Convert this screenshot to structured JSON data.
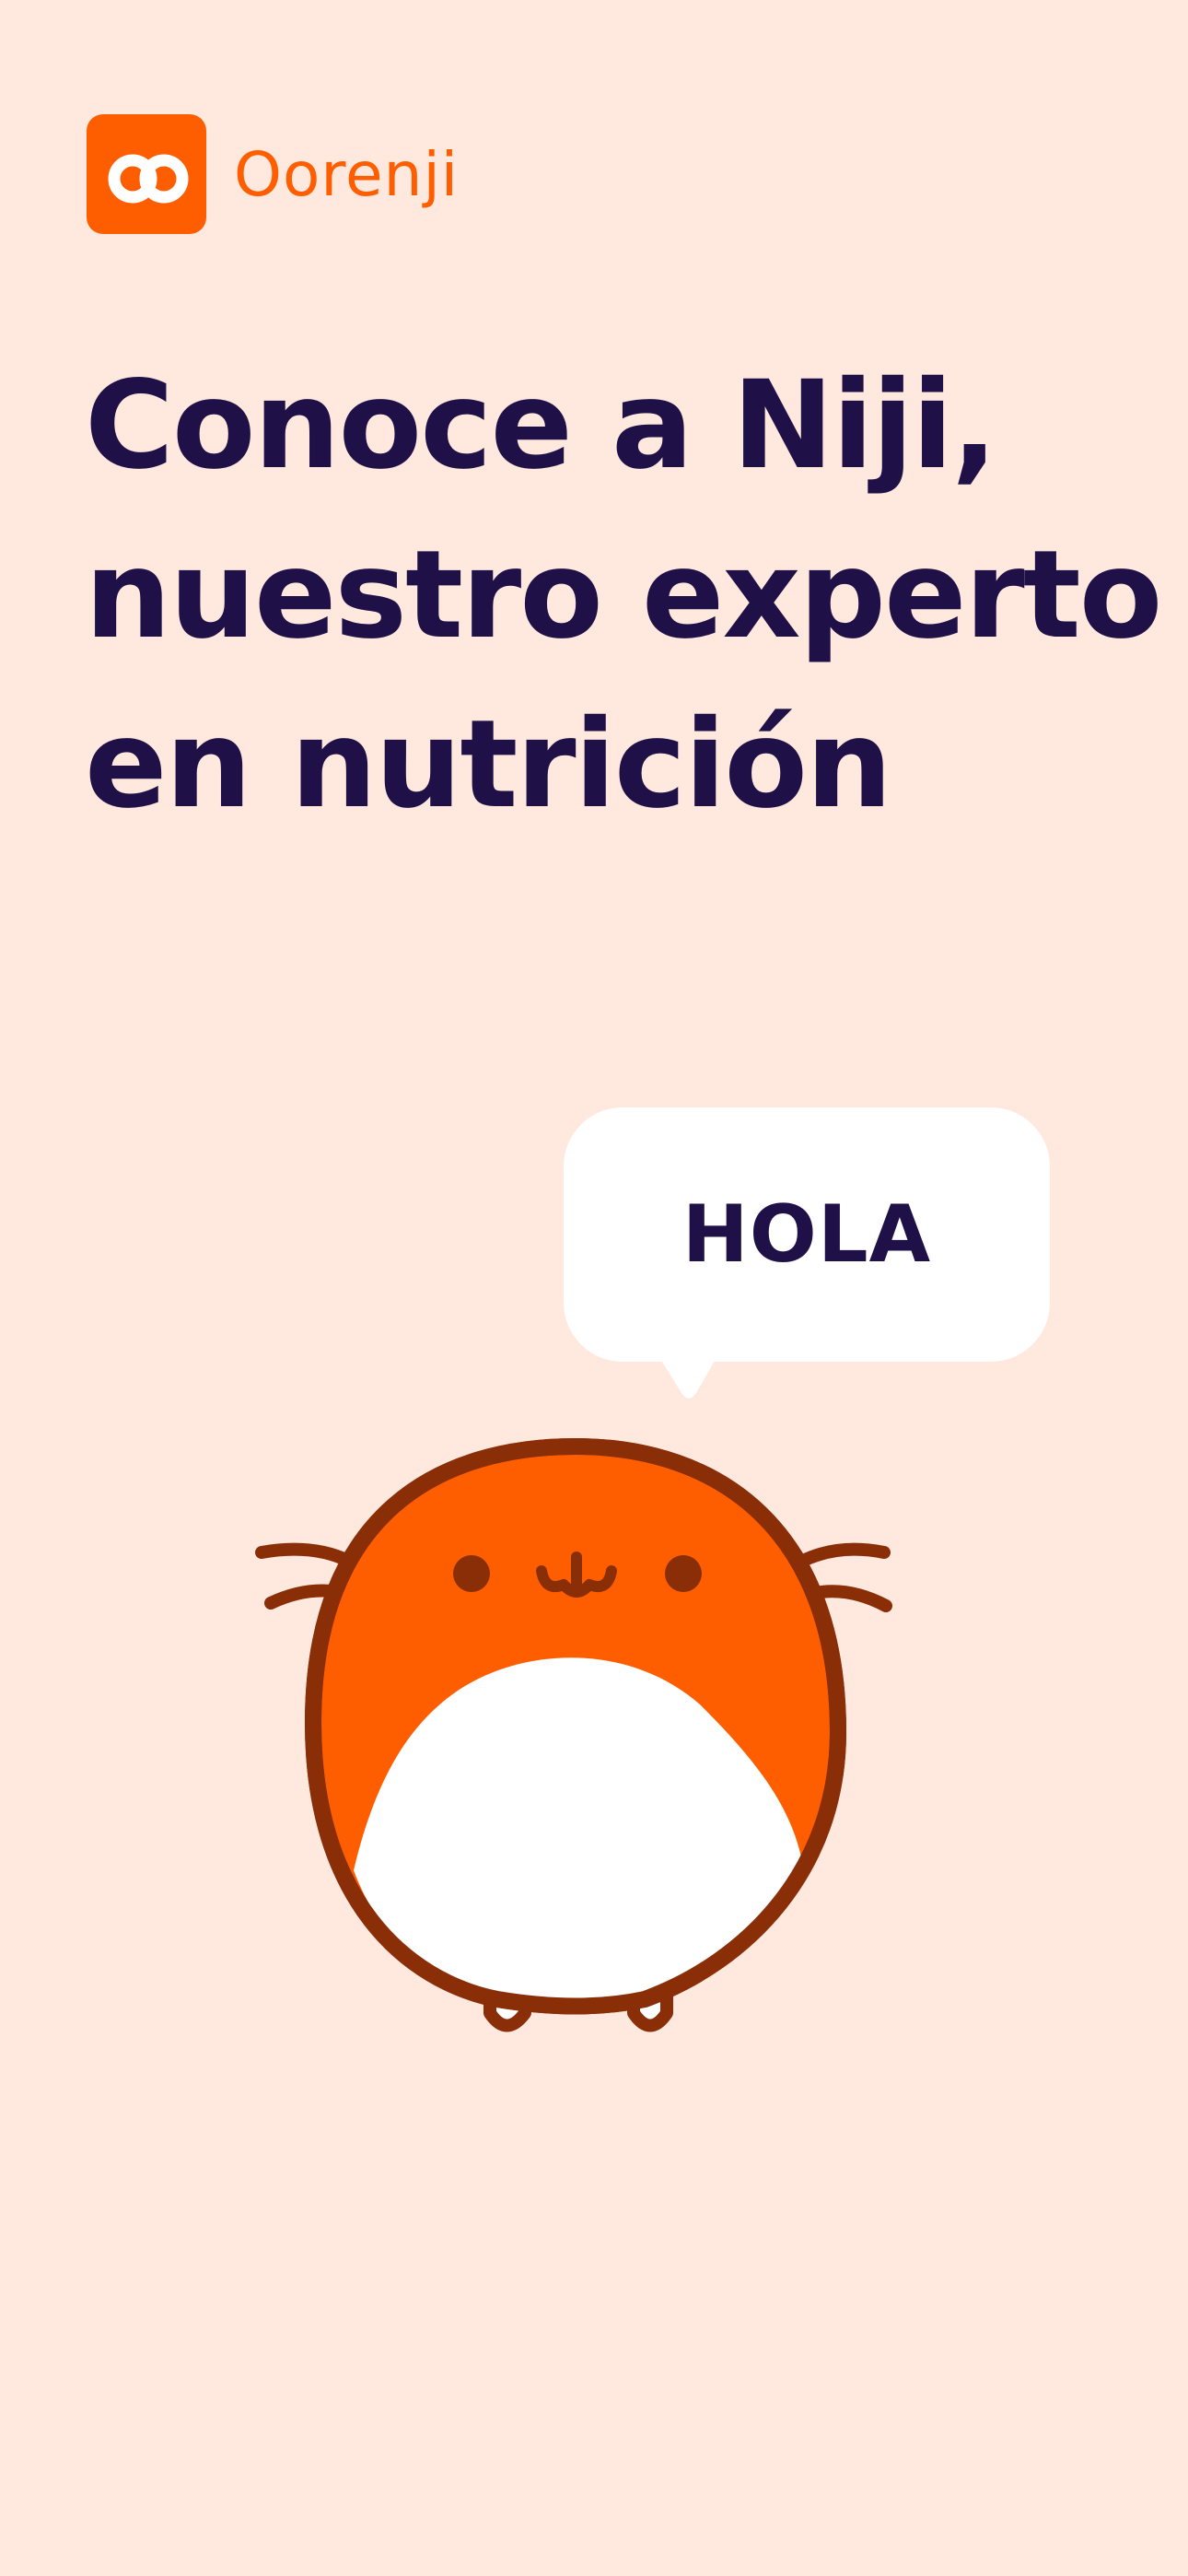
{
  "brand": {
    "name": "Oorenji",
    "logo_icon": "oorenji-logo-icon",
    "color": "#FF5E00"
  },
  "headline": {
    "lines": [
      "Conoce a Niji,",
      "nuestro experto",
      "en nutrición"
    ]
  },
  "speech_bubble": {
    "text": "HOLA"
  },
  "mascot": {
    "icon": "niji-mascot-illustration"
  },
  "colors": {
    "background": "#FFE8DD",
    "accent": "#FF5E00",
    "text_dark": "#1F1147",
    "outline": "#8A2E08"
  }
}
